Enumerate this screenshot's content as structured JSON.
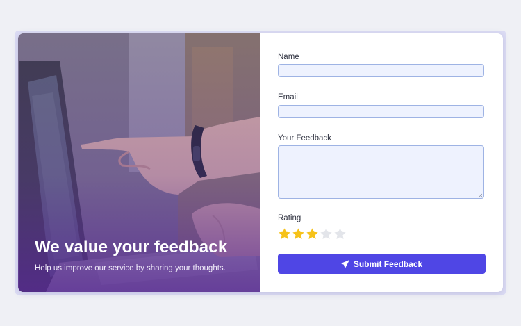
{
  "hero": {
    "title": "We value your feedback",
    "subtitle": "Help us improve our service by sharing your thoughts."
  },
  "form": {
    "name_label": "Name",
    "name_value": "",
    "email_label": "Email",
    "email_value": "",
    "feedback_label": "Your Feedback",
    "feedback_value": "",
    "rating_label": "Rating",
    "rating": {
      "value": 3,
      "max": 5
    },
    "submit_label": "Submit Feedback",
    "submit_icon": "paper-plane-icon"
  },
  "colors": {
    "accent": "#4f46e5",
    "star_filled": "#f6c21a",
    "star_empty": "#e3e5ea",
    "input_bg": "#eef2fe",
    "input_border": "#9eb3e4"
  }
}
